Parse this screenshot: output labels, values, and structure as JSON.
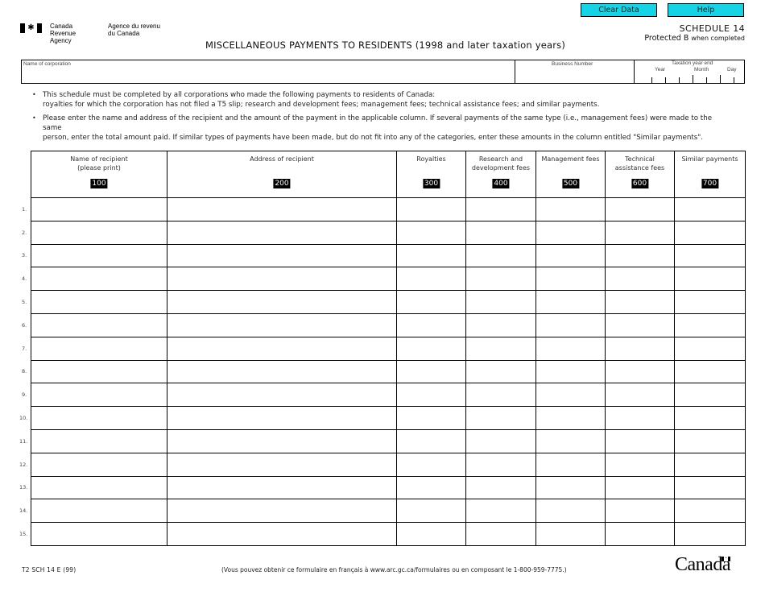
{
  "toolbar": {
    "clear_label": "Clear Data",
    "help_label": "Help",
    "button_color": "#16d3e6"
  },
  "header": {
    "agency_en_line1": "Canada Revenue",
    "agency_en_line2": "Agency",
    "agency_fr_line1": "Agence du revenu",
    "agency_fr_line2": "du Canada",
    "flag_icon": "maple-leaf-flag",
    "schedule": "SCHEDULE 14",
    "protected": "Protected B",
    "protected_suffix": "when completed",
    "title": "MISCELLANEOUS PAYMENTS TO RESIDENTS (1998 and later taxation years)"
  },
  "identification": {
    "corporation_label": "Name of corporation",
    "corporation_value": "",
    "business_number_label": "Business Number",
    "business_number_value": "",
    "tax_year_end_label": "Taxation year end",
    "year_label": "Year",
    "month_label": "Month",
    "day_label": "Day"
  },
  "instructions": [
    {
      "line1": "This schedule must be completed by all corporations who made the following payments to residents of Canada:",
      "line2": "royalties for which the corporation has not filed a T5 slip; research and development fees; management fees; technical assistance fees; and similar payments."
    },
    {
      "line1": "Please enter the name and address of the recipient and the amount of the payment in the applicable column. If several payments of the same type (i.e., management fees) were made to the same",
      "line2": "person, enter the total amount paid. If similar types of payments have been made, but do not fit into any of the categories, enter these amounts in the column entitled \"Similar payments\"."
    }
  ],
  "table": {
    "columns": [
      {
        "line1": "Name of recipient",
        "line2": "(please print)",
        "code": "100"
      },
      {
        "line1": "Address of recipient",
        "line2": "",
        "code": "200"
      },
      {
        "line1": "Royalties",
        "line2": "",
        "code": "300"
      },
      {
        "line1": "Research and",
        "line2": "development fees",
        "code": "400"
      },
      {
        "line1": "Management fees",
        "line2": "",
        "code": "500"
      },
      {
        "line1": "Technical",
        "line2": "assistance fees",
        "code": "600"
      },
      {
        "line1": "Similar payments",
        "line2": "",
        "code": "700"
      }
    ],
    "row_labels": [
      "1.",
      "2.",
      "3.",
      "4.",
      "5.",
      "6.",
      "7.",
      "8.",
      "9.",
      "10.",
      "11.",
      "12.",
      "13.",
      "14.",
      "15."
    ]
  },
  "footer": {
    "form_number": "T2 SCH 14 E (99)",
    "french_note": "(Vous pouvez obtenir ce formulaire en français à www.arc.gc.ca/formulaires ou en composant le 1-800-959-7775.)",
    "wordmark": "Canada"
  }
}
